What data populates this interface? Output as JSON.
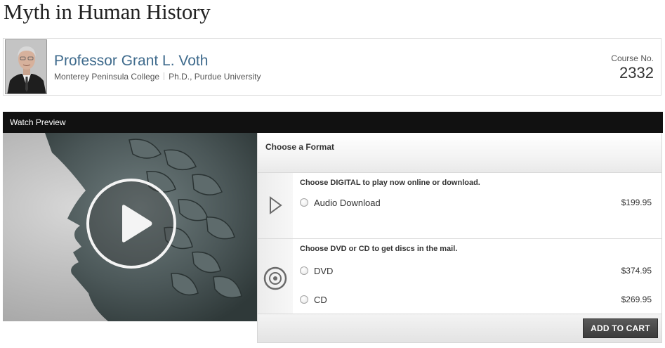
{
  "page": {
    "title": "Myth in Human History"
  },
  "professor": {
    "name": "Professor Grant L. Voth",
    "institution": "Monterey Peninsula College",
    "degree": "Ph.D., Purdue University",
    "photo_icon": "professor-portrait"
  },
  "course": {
    "label": "Course No.",
    "number": "2332"
  },
  "preview": {
    "label": "Watch Preview",
    "play_icon": "play-icon"
  },
  "formats": {
    "header": "Choose a Format",
    "digital": {
      "title": "Choose DIGITAL to play now online or download.",
      "icon": "play-outline-icon",
      "options": [
        {
          "label": "Audio Download",
          "price": "$199.95"
        }
      ]
    },
    "discs": {
      "title": "Choose DVD or CD to get discs in the mail.",
      "icon": "disc-icon",
      "options": [
        {
          "label": "DVD",
          "price": "$374.95"
        },
        {
          "label": "CD",
          "price": "$269.95"
        }
      ]
    },
    "cart_button": "ADD TO CART"
  },
  "colors": {
    "name_link": "#3e6a8c",
    "preview_bar": "#111111",
    "cart_button": "#4a4a4a"
  }
}
